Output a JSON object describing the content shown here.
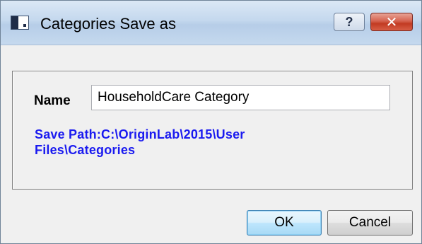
{
  "window": {
    "title": "Categories Save as",
    "help_label": "?",
    "close_label": "✕"
  },
  "form": {
    "name_label": "Name",
    "name_value": "HouseholdCare Category",
    "save_path_line1": "Save Path:C:\\OriginLab\\2015\\User",
    "save_path_line2": "Files\\Categories"
  },
  "buttons": {
    "ok_label": "OK",
    "cancel_label": "Cancel"
  }
}
